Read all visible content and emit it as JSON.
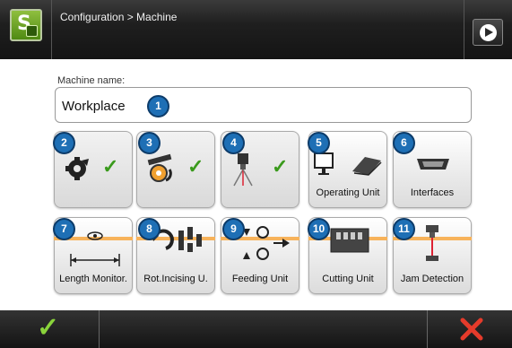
{
  "header": {
    "breadcrumb": "Configuration > Machine"
  },
  "machine_name": {
    "label": "Machine name:",
    "value": "Workplace"
  },
  "tiles": [
    {
      "badge": "2",
      "label": "",
      "checked": true
    },
    {
      "badge": "3",
      "label": "",
      "checked": true
    },
    {
      "badge": "4",
      "label": "",
      "checked": true
    },
    {
      "badge": "5",
      "label": "Operating Unit"
    },
    {
      "badge": "6",
      "label": "Interfaces"
    },
    {
      "badge": "7",
      "label": "Length Monitor."
    },
    {
      "badge": "8",
      "label": "Rot.Incising U."
    },
    {
      "badge": "9",
      "label": "Feeding Unit"
    },
    {
      "badge": "10",
      "label": "Cutting Unit"
    },
    {
      "badge": "11",
      "label": "Jam Detection"
    }
  ],
  "name_badge": "1",
  "check_glyph": "✓",
  "colors": {
    "badge": "#1e6fb5",
    "check": "#3a9a1c",
    "accent": "#f7b25a",
    "cancel": "#e53b2b"
  }
}
